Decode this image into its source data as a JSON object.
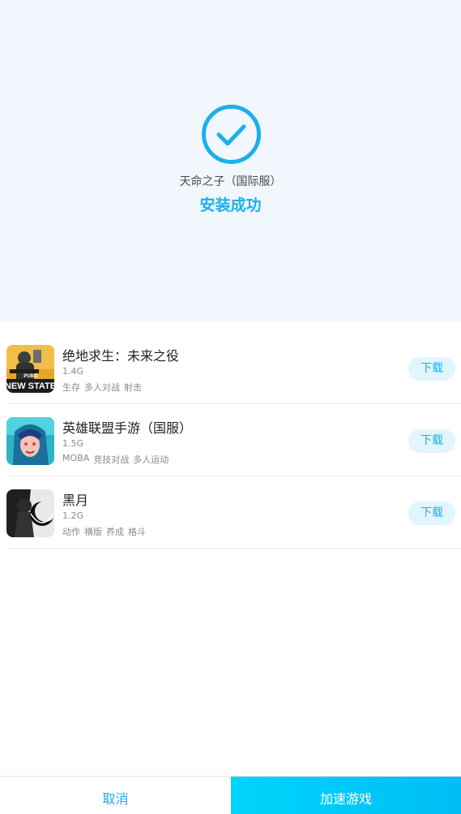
{
  "header": {
    "app_name": "天命之子（国际服）",
    "status": "安装成功",
    "icon": "check-circle-icon",
    "accent_color": "#1ab0ea"
  },
  "recommendations": [
    {
      "title": "绝地求生：未来之役",
      "size": "1.4G",
      "tags": [
        "生存",
        "多人对战",
        "射击"
      ],
      "button": "下载",
      "icon_text": "NEW STATE",
      "icon_badge": "PUBG"
    },
    {
      "title": "英雄联盟手游（国服）",
      "size": "1.5G",
      "tags": [
        "MOBA",
        "竞技对战",
        "多人运动"
      ],
      "button": "下载"
    },
    {
      "title": "黑月",
      "size": "1.2G",
      "tags": [
        "动作",
        "横版",
        "养成",
        "格斗"
      ],
      "button": "下载"
    }
  ],
  "bottom_bar": {
    "cancel": "取消",
    "accelerate": "加速游戏"
  }
}
